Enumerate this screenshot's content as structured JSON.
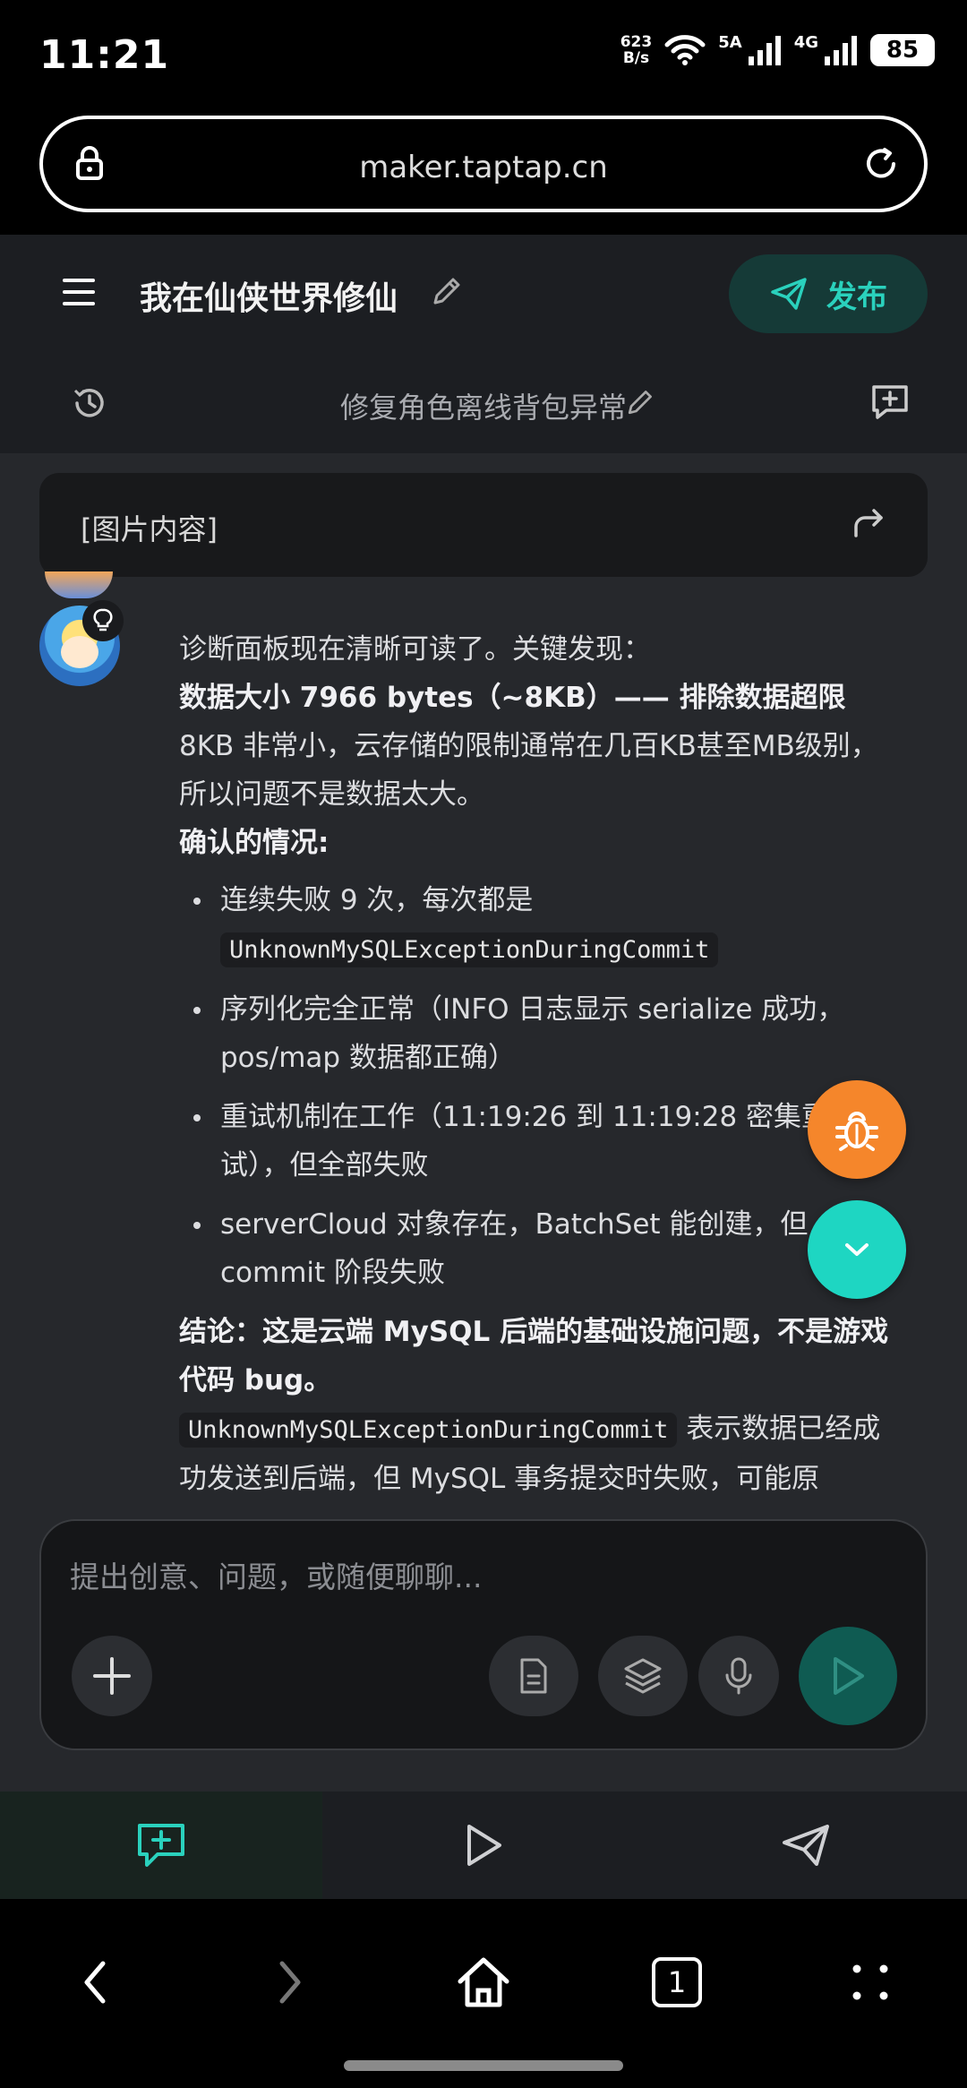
{
  "status_bar": {
    "time": "11:21",
    "net_speed_value": "623",
    "net_speed_unit": "B/s",
    "signal1_label": "5A",
    "signal2_label": "4G",
    "battery": "85"
  },
  "browser": {
    "url": "maker.taptap.cn"
  },
  "header": {
    "title": "我在仙侠世界修仙",
    "publish_label": "发布"
  },
  "session": {
    "title": "修复角色离线背包异常"
  },
  "chat": {
    "image_card_label": "[图片内容]",
    "message": {
      "line1": "诊断面板现在清晰可读了。关键发现：",
      "headline": "数据大小 7966 bytes（~8KB）—— 排除数据超限",
      "para1": "8KB 非常小，云存储的限制通常在几百KB甚至MB级别，所以问题不是数据太大。",
      "confirmed_heading": "确认的情况:",
      "bullets": [
        {
          "text": "连续失败 9 次，每次都是",
          "code": "UnknownMySQLExceptionDuringCommit"
        },
        {
          "text": "序列化完全正常（INFO 日志显示 serialize 成功，pos/map 数据都正确）"
        },
        {
          "text": "重试机制在工作（11:19:26 到 11:19:28 密集重试），但全部失败"
        },
        {
          "text": "serverCloud 对象存在，BatchSet 能创建，但 commit 阶段失败"
        }
      ],
      "conclusion": "结论：这是云端 MySQL 后端的基础设施问题，不是游戏代码 bug。",
      "final_code": "UnknownMySQLExceptionDuringCommit",
      "final_text": " 表示数据已经成功发送到后端，但 MySQL 事务提交时失败，可能原"
    }
  },
  "composer": {
    "placeholder": "提出创意、问题，或随便聊聊..."
  },
  "colors": {
    "accent": "#2ad1bd",
    "bug_button": "#f5862b",
    "scroll_button": "#1ed6c2",
    "chat_bg": "#26282c"
  },
  "system_nav": {
    "tab_count": "1"
  }
}
